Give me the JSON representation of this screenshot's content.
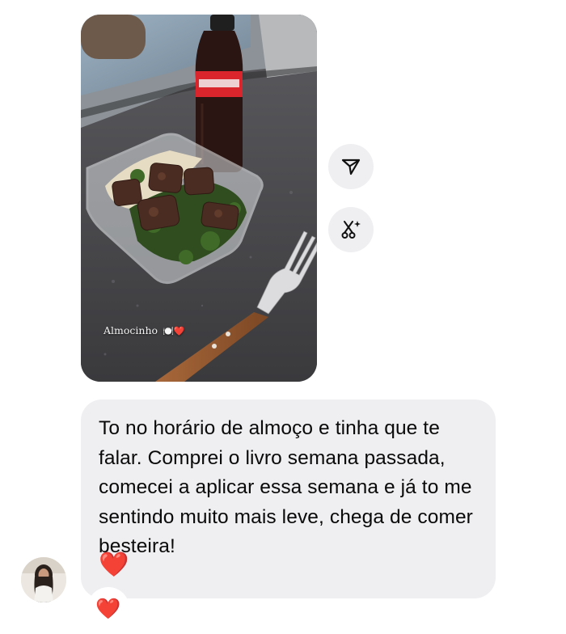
{
  "story": {
    "caption": "Almocinho",
    "caption_emojis": "🍽️❤️",
    "buttons": [
      {
        "icon": "share-paper-plane-icon"
      },
      {
        "icon": "remix-scissors-sparkle-icon"
      }
    ]
  },
  "message": {
    "text": "To no horário de almoço e tinha que te falar. Comprei o livro semana passada, comecei a aplicar essa semana e já to me sentindo muito mais leve, chega de comer besteira!",
    "emoji": "❤️"
  },
  "reaction": {
    "emoji": "❤️"
  },
  "colors": {
    "bubble": "#efeff2",
    "heart": "#ee1c25",
    "icon": "#111111"
  }
}
